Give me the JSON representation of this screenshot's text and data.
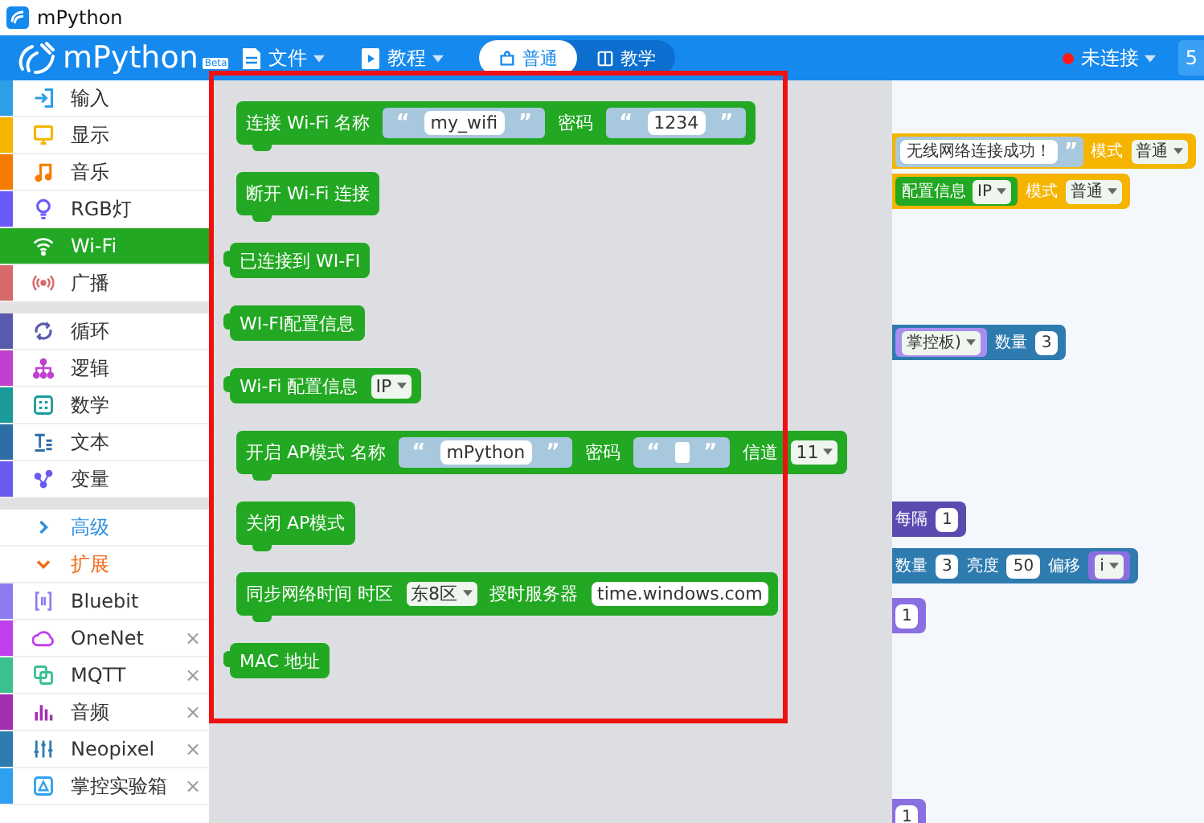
{
  "window": {
    "title": "mPython"
  },
  "header": {
    "logo": "mPython",
    "badge": "Beta",
    "menus": [
      {
        "label": "文件"
      },
      {
        "label": "教程"
      }
    ],
    "modes": [
      {
        "label": "普通",
        "selected": true
      },
      {
        "label": "教学",
        "selected": false
      }
    ],
    "status": {
      "label": "未连接",
      "connected": false
    },
    "edge_text": "5"
  },
  "sidebar": {
    "sections": [
      {
        "items": [
          {
            "kind": "category",
            "label": "输入",
            "color": "#2e9fe6",
            "selected": false
          },
          {
            "kind": "category",
            "label": "显示",
            "color": "#f5b400",
            "selected": false
          },
          {
            "kind": "category",
            "label": "音乐",
            "color": "#f57c00",
            "selected": false
          },
          {
            "kind": "category",
            "label": "RGB灯",
            "color": "#6a5af9",
            "selected": false
          },
          {
            "kind": "category",
            "label": "Wi-Fi",
            "color": "#22a822",
            "selected": true
          },
          {
            "kind": "category",
            "label": "广播",
            "color": "#d66a6a",
            "selected": false
          }
        ]
      },
      {
        "items": [
          {
            "kind": "category",
            "label": "循环",
            "color": "#5b5bad",
            "selected": false
          },
          {
            "kind": "category",
            "label": "逻辑",
            "color": "#c040d0",
            "selected": false
          },
          {
            "kind": "category",
            "label": "数学",
            "color": "#1a9a9a",
            "selected": false
          },
          {
            "kind": "category",
            "label": "文本",
            "color": "#2e6ea6",
            "selected": false
          },
          {
            "kind": "category",
            "label": "变量",
            "color": "#6a5af0",
            "selected": false
          }
        ]
      },
      {
        "items": [
          {
            "kind": "toggle",
            "label": "高级",
            "color": "#2e8fe0",
            "expanded": false,
            "selected": false
          },
          {
            "kind": "toggle",
            "label": "扩展",
            "color": "#f06a1a",
            "expanded": true,
            "selected": false
          },
          {
            "kind": "category",
            "label": "Bluebit",
            "color": "#8c7cf0",
            "selected": false
          },
          {
            "kind": "category",
            "label": "OneNet",
            "color": "#c040f0",
            "selected": false,
            "close": "×"
          },
          {
            "kind": "category",
            "label": "MQTT",
            "color": "#3cc090",
            "selected": false,
            "close": "×"
          },
          {
            "kind": "category",
            "label": "音频",
            "color": "#a030b0",
            "selected": false,
            "close": "×"
          },
          {
            "kind": "category",
            "label": "Neopixel",
            "color": "#2e7bb0",
            "selected": false,
            "close": "×"
          },
          {
            "kind": "category",
            "label": "掌控实验箱",
            "color": "#2ea0f0",
            "selected": false,
            "close": "×"
          }
        ]
      }
    ]
  },
  "workspace": [
    {
      "color": "#f5b400",
      "parts": [
        {
          "kind": "str",
          "text": "无线网络连接成功！",
          "close": "”"
        },
        {
          "kind": "label",
          "text": "模式"
        },
        {
          "kind": "dropdown",
          "text": "普通"
        }
      ]
    },
    {
      "color": "#f5b400",
      "parts": [
        {
          "kind": "block",
          "color": "#22a822",
          "parts": [
            {
              "kind": "label",
              "text": "配置信息"
            },
            {
              "kind": "dropdown",
              "text": "IP"
            }
          ]
        },
        {
          "kind": "label",
          "text": "模式"
        },
        {
          "kind": "dropdown",
          "text": "普通"
        }
      ]
    },
    {
      "color": "#2e7bb0",
      "parts": [
        {
          "kind": "block",
          "color": "#a98ef0",
          "parts": [
            {
              "kind": "dropdown",
              "text": "掌控板)"
            }
          ]
        },
        {
          "kind": "label",
          "text": "数量"
        },
        {
          "kind": "num",
          "text": "3"
        }
      ]
    },
    {
      "color": "#5b4bb0",
      "parts": [
        {
          "kind": "label",
          "text": "每隔"
        },
        {
          "kind": "num",
          "text": "1"
        }
      ]
    },
    {
      "color": "#2e7bb0",
      "parts": [
        {
          "kind": "label",
          "text": "数量"
        },
        {
          "kind": "num",
          "text": "3"
        },
        {
          "kind": "label",
          "text": "亮度"
        },
        {
          "kind": "num",
          "text": "50"
        },
        {
          "kind": "label",
          "text": "偏移"
        },
        {
          "kind": "block",
          "color": "#8a6fe0",
          "parts": [
            {
              "kind": "dropdown",
              "text": "i"
            }
          ]
        }
      ]
    },
    {
      "color": "#8a6fe0",
      "parts": [
        {
          "kind": "num",
          "text": "1"
        }
      ]
    },
    {
      "color": "#8a6fe0",
      "parts": [
        {
          "kind": "num",
          "text": "1"
        }
      ]
    }
  ],
  "flyout": [
    {
      "kind": "statement",
      "parts": [
        {
          "kind": "label",
          "text": "连接 Wi-Fi 名称"
        },
        {
          "kind": "str",
          "open": "“",
          "text": "my_wifi",
          "close": "”"
        },
        {
          "kind": "label",
          "text": "密码"
        },
        {
          "kind": "str",
          "open": "“",
          "text": "1234",
          "close": "”"
        }
      ]
    },
    {
      "kind": "statement",
      "parts": [
        {
          "kind": "label",
          "text": "断开 Wi-Fi 连接"
        }
      ]
    },
    {
      "kind": "value",
      "parts": [
        {
          "kind": "label",
          "text": "已连接到 WI-FI"
        }
      ]
    },
    {
      "kind": "value",
      "parts": [
        {
          "kind": "label",
          "text": "WI-FI配置信息"
        }
      ]
    },
    {
      "kind": "value",
      "parts": [
        {
          "kind": "label",
          "text": "Wi-Fi 配置信息"
        },
        {
          "kind": "dropdown",
          "text": "IP"
        }
      ]
    },
    {
      "kind": "statement",
      "parts": [
        {
          "kind": "label",
          "text": "开启 AP模式 名称"
        },
        {
          "kind": "str",
          "open": "“",
          "text": "mPython",
          "close": "”"
        },
        {
          "kind": "label",
          "text": "密码"
        },
        {
          "kind": "str",
          "open": "“",
          "close": "”"
        },
        {
          "kind": "label",
          "text": "信道"
        },
        {
          "kind": "dropdown",
          "text": "11"
        }
      ]
    },
    {
      "kind": "statement",
      "parts": [
        {
          "kind": "label",
          "text": "关闭 AP模式"
        }
      ]
    },
    {
      "kind": "statement",
      "parts": [
        {
          "kind": "label",
          "text": "同步网络时间 时区"
        },
        {
          "kind": "dropdown",
          "text": "东8区"
        },
        {
          "kind": "label",
          "text": "授时服务器"
        },
        {
          "kind": "field",
          "text": "time.windows.com"
        }
      ]
    },
    {
      "kind": "value",
      "parts": [
        {
          "kind": "label",
          "text": "MAC 地址"
        }
      ]
    }
  ]
}
